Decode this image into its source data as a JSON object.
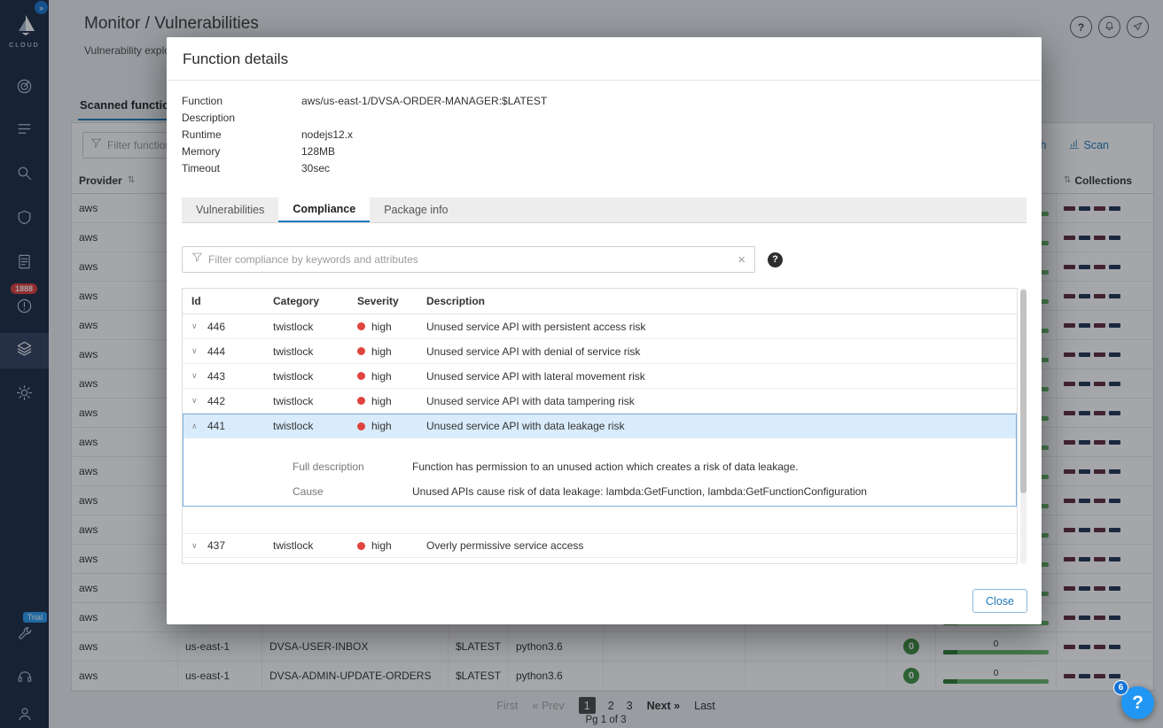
{
  "colors": {
    "accent": "#2079b8",
    "severity_high": "#e0443e",
    "alert_badge": "#e23d3d",
    "trial_badge": "#2a9df4",
    "count_badge_green": "#3f9142",
    "bar_green": "#68b768",
    "fab_blue": "#2196f3"
  },
  "icons": {
    "sort": "⇅",
    "chevron_down": "∨",
    "chevron_up": "∧",
    "clear_x": "×",
    "help_q": "?",
    "expand_chevrons": "»"
  },
  "sidebar": {
    "logo_label": "CLOUD",
    "alert_count": "1888",
    "trial_label": "Trial"
  },
  "header": {
    "breadcrumb": "Monitor / Vulnerabilities",
    "subtitle": "Vulnerability explor"
  },
  "toolbar": {
    "tab_label": "Scanned functions",
    "filter_placeholder": "Filter functions by",
    "refresh_label": "fresh",
    "scan_label": "Scan"
  },
  "functions_table": {
    "provider_header": "Provider",
    "collections_header": "Collections",
    "dash_colors": [
      "#612a3e",
      "#253454",
      "#612a3e",
      "#253454"
    ],
    "rows": [
      {
        "provider": "aws"
      },
      {
        "provider": "aws"
      },
      {
        "provider": "aws"
      },
      {
        "provider": "aws"
      },
      {
        "provider": "aws"
      },
      {
        "provider": "aws"
      },
      {
        "provider": "aws"
      },
      {
        "provider": "aws"
      },
      {
        "provider": "aws"
      },
      {
        "provider": "aws"
      },
      {
        "provider": "aws"
      },
      {
        "provider": "aws"
      },
      {
        "provider": "aws"
      },
      {
        "provider": "aws"
      },
      {
        "provider": "aws"
      },
      {
        "provider": "aws",
        "region": "us-east-1",
        "function": "DVSA-USER-INBOX",
        "version": "$LATEST",
        "runtime": "python3.6",
        "vuln_badge": "0",
        "bar_label": "0"
      },
      {
        "provider": "aws",
        "region": "us-east-1",
        "function": "DVSA-ADMIN-UPDATE-ORDERS",
        "version": "$LATEST",
        "runtime": "python3.6",
        "vuln_badge": "0",
        "bar_label": "0"
      }
    ]
  },
  "pagination": {
    "first": "First",
    "prev": "« Prev",
    "pages": [
      "1",
      "2",
      "3"
    ],
    "active_page": "1",
    "next": "Next »",
    "last": "Last",
    "status": "Pg 1 of 3"
  },
  "modal": {
    "title": "Function details",
    "details": [
      {
        "label": "Function",
        "value": "aws/us-east-1/DVSA-ORDER-MANAGER:$LATEST"
      },
      {
        "label": "Description",
        "value": ""
      },
      {
        "label": "Runtime",
        "value": "nodejs12.x"
      },
      {
        "label": "Memory",
        "value": "128MB"
      },
      {
        "label": "Timeout",
        "value": "30sec"
      }
    ],
    "tabs": [
      "Vulnerabilities",
      "Compliance",
      "Package info"
    ],
    "active_tab": "Compliance",
    "filter_placeholder": "Filter compliance by keywords and attributes",
    "compliance": {
      "headers": [
        "Id",
        "Category",
        "Severity",
        "Description"
      ],
      "rows": [
        {
          "id": "446",
          "category": "twistlock",
          "severity": "high",
          "description": "Unused service API with persistent access risk",
          "expanded": false
        },
        {
          "id": "444",
          "category": "twistlock",
          "severity": "high",
          "description": "Unused service API with denial of service risk",
          "expanded": false
        },
        {
          "id": "443",
          "category": "twistlock",
          "severity": "high",
          "description": "Unused service API with lateral movement risk",
          "expanded": false
        },
        {
          "id": "442",
          "category": "twistlock",
          "severity": "high",
          "description": "Unused service API with data tampering risk",
          "expanded": false
        },
        {
          "id": "441",
          "category": "twistlock",
          "severity": "high",
          "description": "Unused service API with data leakage risk",
          "expanded": true,
          "full_description_label": "Full description",
          "full_description": "Function has permission to an unused action which creates a risk of data leakage.",
          "cause_label": "Cause",
          "cause": "Unused APIs cause risk of data leakage: lambda:GetFunction, lambda:GetFunctionConfiguration"
        },
        {
          "id": "437",
          "category": "twistlock",
          "severity": "high",
          "description": "Overly permissive service access",
          "expanded": false
        }
      ]
    },
    "close_label": "Close"
  },
  "help_fab": {
    "label": "?",
    "badge": "6"
  }
}
